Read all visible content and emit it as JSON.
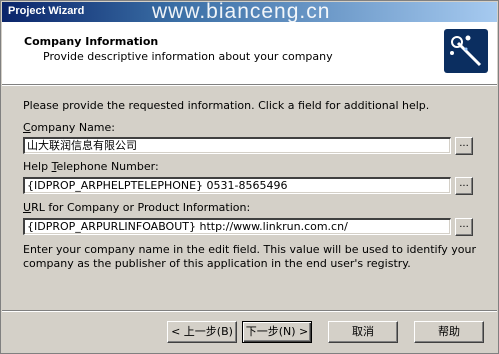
{
  "window": {
    "title": "Project Wizard",
    "watermark": "www.bianceng.cn"
  },
  "header": {
    "title": "Company Information",
    "subtitle": "Provide descriptive information about your company",
    "icon": "wizard-wand-icon"
  },
  "intro": "Please provide the requested information. Click a field for additional help.",
  "fields": {
    "company_name": {
      "label_pre": "",
      "label_accel": "C",
      "label_post": "ompany Name:",
      "value": "山大联润信息有限公司"
    },
    "help_phone": {
      "label_pre": "Help ",
      "label_accel": "T",
      "label_post": "elephone Number:",
      "value": "{IDPROP_ARPHELPTELEPHONE} 0531-8565496"
    },
    "url": {
      "label_pre": "",
      "label_accel": "U",
      "label_post": "RL for Company or Product Information:",
      "value": "{IDPROP_ARPURLINFOABOUT} http://www.linkrun.com.cn/"
    },
    "browse_label": "..."
  },
  "description": "Enter your company name in the edit field. This value will be used to identify your company as the publisher of this application in the end user's registry.",
  "buttons": {
    "back": "< 上一步(B)",
    "next": "下一步(N) >",
    "cancel": "取消",
    "help": "帮助"
  }
}
